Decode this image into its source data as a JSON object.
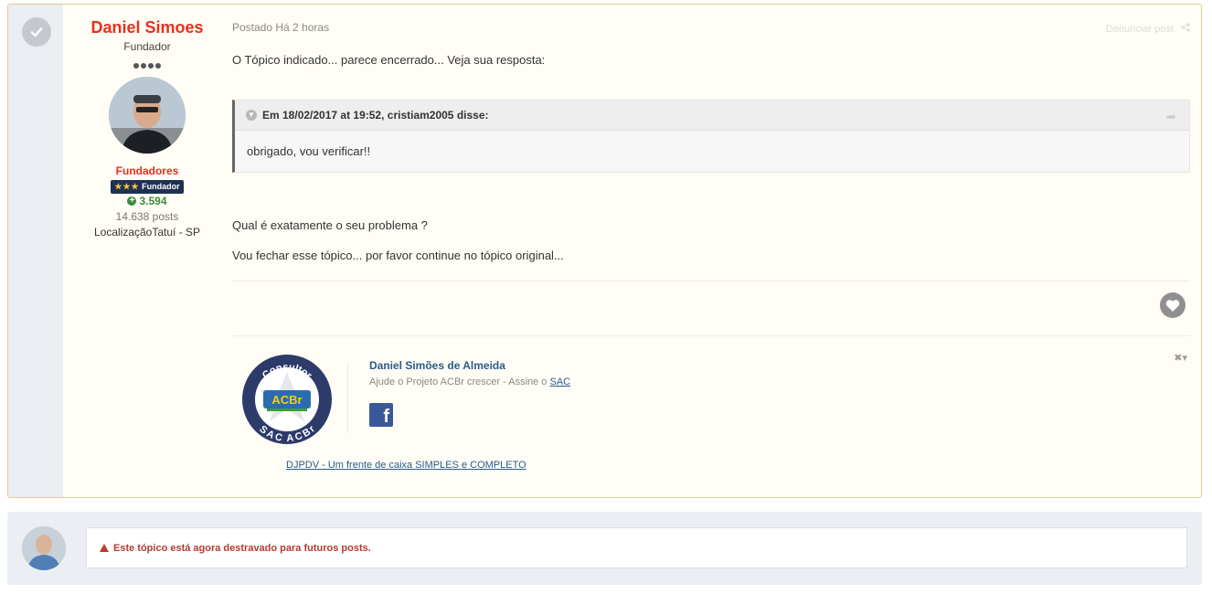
{
  "post": {
    "author": {
      "name": "Daniel Simoes",
      "title": "Fundador",
      "group": "Fundadores",
      "badge_label": "Fundador",
      "reputation": "3.594",
      "posts": "14.638 posts",
      "location": "LocalizaçãoTatuí - SP"
    },
    "meta": "Postado Há 2 horas",
    "share_label": "Denunciar post",
    "paragraph1": "O Tópico indicado... parece encerrado... Veja sua resposta:",
    "quote": {
      "header": "Em 18/02/2017 at 19:52, cristiam2005 disse:",
      "body": "obrigado, vou verificar!!"
    },
    "paragraph2": "Qual é exatamente o seu problema ?",
    "paragraph3": "Vou fechar esse tópico... por favor continue no tópico original...",
    "signature": {
      "seal_top": "Consultor",
      "seal_bottom": "SAC ACBr",
      "seal_logo": "ACBr",
      "name": "Daniel Simões de Almeida",
      "line_prefix": "Ajude o Projeto ACBr crescer - Assine o ",
      "line_link": "SAC",
      "footer_link": "DJPDV - Um frente de caixa SIMPLES e COMPLETO"
    }
  },
  "locked_notice": {
    "text": "Este tópico está agora destravado para futuros posts."
  },
  "colors": {
    "author_red": "#e8301b",
    "link_blue": "#2b5b8a",
    "post_border": "#e4c98f",
    "warning_red": "#b33b2e"
  }
}
